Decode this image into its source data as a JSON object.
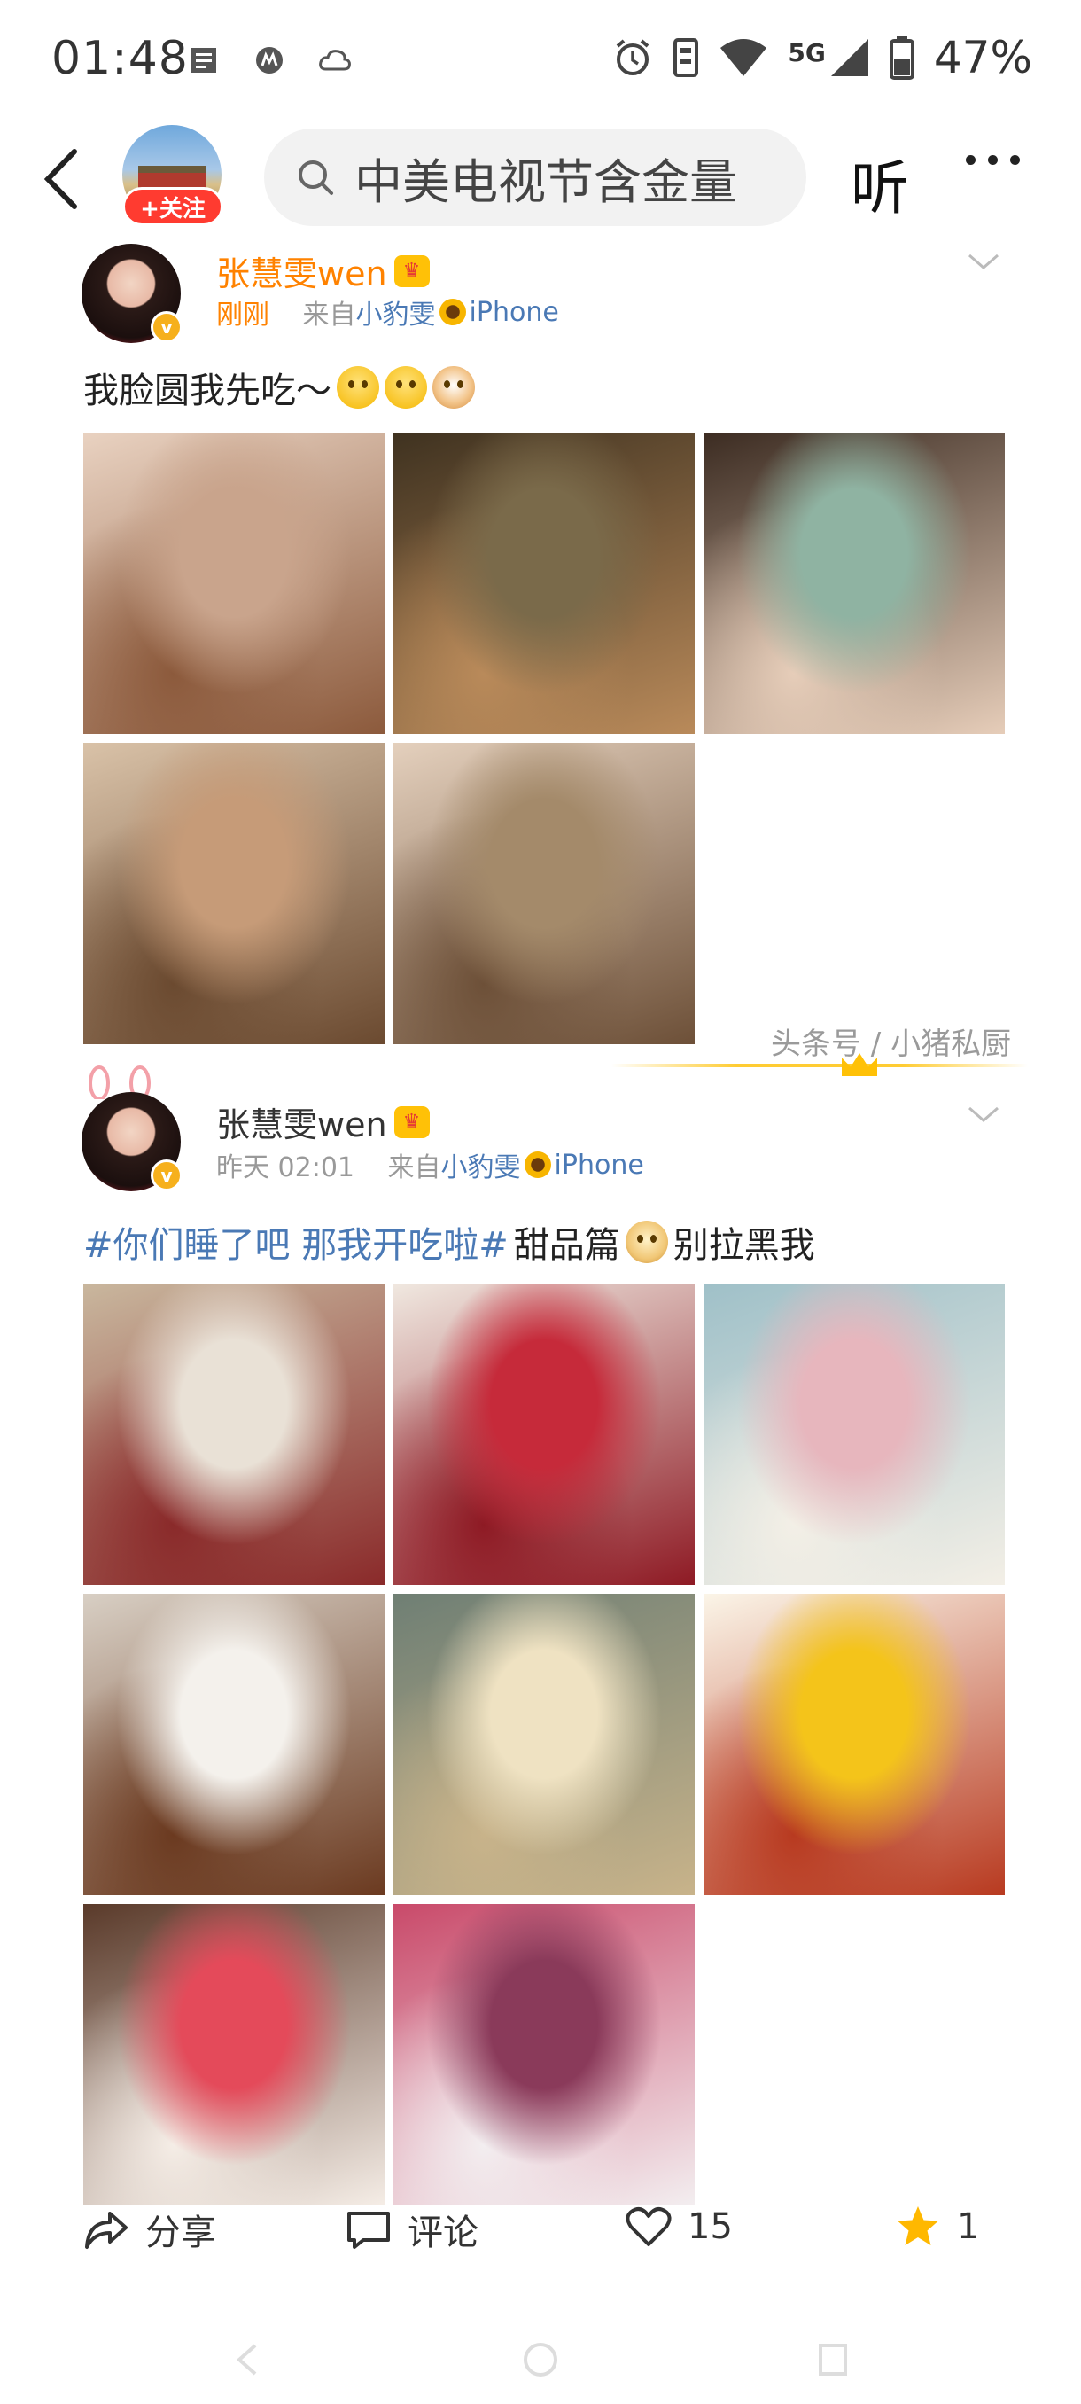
{
  "status_bar": {
    "time": "01:48",
    "network": "5G",
    "battery": "47%",
    "left_icons": [
      "notes-icon",
      "motorola-icon",
      "cloud-icon"
    ],
    "right_icons": [
      "alarm-icon",
      "sim-icon",
      "wifi-icon",
      "signal-icon",
      "battery-icon"
    ]
  },
  "topnav": {
    "follow_label": "+关注",
    "search_text": "中美电视节含金量",
    "listen_label": "听"
  },
  "posts": [
    {
      "author": "张慧雯wen",
      "time": "刚刚",
      "source_prefix": "来自",
      "source_name": "小豹雯",
      "source_device": "iPhone",
      "text": "我脸圆我先吃～",
      "photos": [
        {
          "desc": "girl-eating-1",
          "colors": [
            "#c9a48c",
            "#8c5a3c",
            "#e9d2c1"
          ]
        },
        {
          "desc": "girl-eating-2",
          "colors": [
            "#7a6a4a",
            "#b98a5a",
            "#3f3220"
          ]
        },
        {
          "desc": "girl-eating-3",
          "colors": [
            "#8fb3a2",
            "#e6cdb9",
            "#3c2c22"
          ]
        },
        {
          "desc": "girl-eating-4",
          "colors": [
            "#c69b78",
            "#6b4a30",
            "#d9c2a8"
          ]
        },
        {
          "desc": "girl-eating-5",
          "colors": [
            "#a48a6a",
            "#6d5038",
            "#e4d0bd"
          ]
        }
      ]
    },
    {
      "author": "张慧雯wen",
      "time": "昨天 02:01",
      "source_prefix": "来自",
      "source_name": "小豹雯",
      "source_device": "iPhone",
      "hashtag": "#你们睡了吧 那我开吃啦#",
      "text_mid": " 甜品篇",
      "text_end": "别拉黑我",
      "photos": [
        {
          "desc": "chocolate-dessert-table",
          "colors": [
            "#e9e1d6",
            "#8a2a2a",
            "#c9b79e"
          ]
        },
        {
          "desc": "raspberry-cake",
          "colors": [
            "#c62a3a",
            "#8e1a24",
            "#f0e8e0"
          ]
        },
        {
          "desc": "milkshakes",
          "colors": [
            "#e7b6bd",
            "#f3efe6",
            "#9fc0c8"
          ]
        },
        {
          "desc": "chocolate-balls",
          "colors": [
            "#f4f1ec",
            "#6b3a20",
            "#d8cfc4"
          ]
        },
        {
          "desc": "ice-cream-sundae",
          "colors": [
            "#efe2c2",
            "#c8b38a",
            "#6f7f74"
          ]
        },
        {
          "desc": "starfruit-pudding",
          "colors": [
            "#f4c41a",
            "#b83a20",
            "#fbf5e8"
          ]
        },
        {
          "desc": "strawberry-cheesecake",
          "colors": [
            "#e44a5a",
            "#f5ede6",
            "#5a3a2a"
          ]
        },
        {
          "desc": "lava-cake",
          "colors": [
            "#8a3a5a",
            "#f3eef0",
            "#c94a6a"
          ]
        }
      ]
    }
  ],
  "watermark": "头条号 / 小猪私厨",
  "actions": {
    "share": "分享",
    "comment": "评论",
    "likes": "15",
    "favorites": "1"
  },
  "colors": {
    "accent_orange": "#ff8200",
    "link_blue": "#4a79b5",
    "follow_red": "#ff3b30",
    "star_yellow": "#ffb800"
  }
}
